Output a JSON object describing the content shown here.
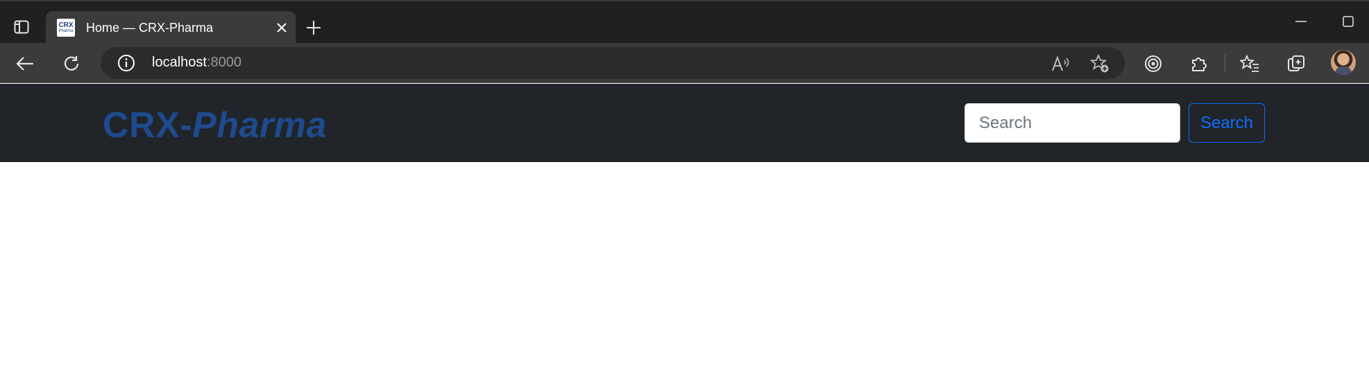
{
  "browser": {
    "tab": {
      "title": "Home — CRX-Pharma",
      "favicon_line1": "CRX",
      "favicon_line2": "Pharma"
    },
    "address": {
      "host": "localhost",
      "port": ":8000"
    },
    "icons": {
      "tab_actions": "tab-actions-icon",
      "close": "close-icon",
      "new_tab": "plus-icon",
      "minimize": "minimize-icon",
      "maximize": "maximize-icon",
      "back": "back-arrow-icon",
      "refresh": "refresh-icon",
      "site_info": "info-icon",
      "read_aloud": "read-aloud-icon",
      "add_favorite": "star-add-icon",
      "browser_essentials": "essentials-icon",
      "extensions": "puzzle-icon",
      "favorites": "favorites-icon",
      "collections": "collections-icon",
      "profile": "avatar"
    }
  },
  "navbar": {
    "brand_part1": "CRX-",
    "brand_part2": "Pharma",
    "search_placeholder": "Search",
    "search_value": "",
    "search_button": "Search"
  },
  "colors": {
    "navbar_bg": "#212529",
    "brand": "#1e4a8e",
    "accent": "#0d6efd",
    "tabstrip_bg": "#202020",
    "toolbar_bg": "#3b3b3b"
  }
}
